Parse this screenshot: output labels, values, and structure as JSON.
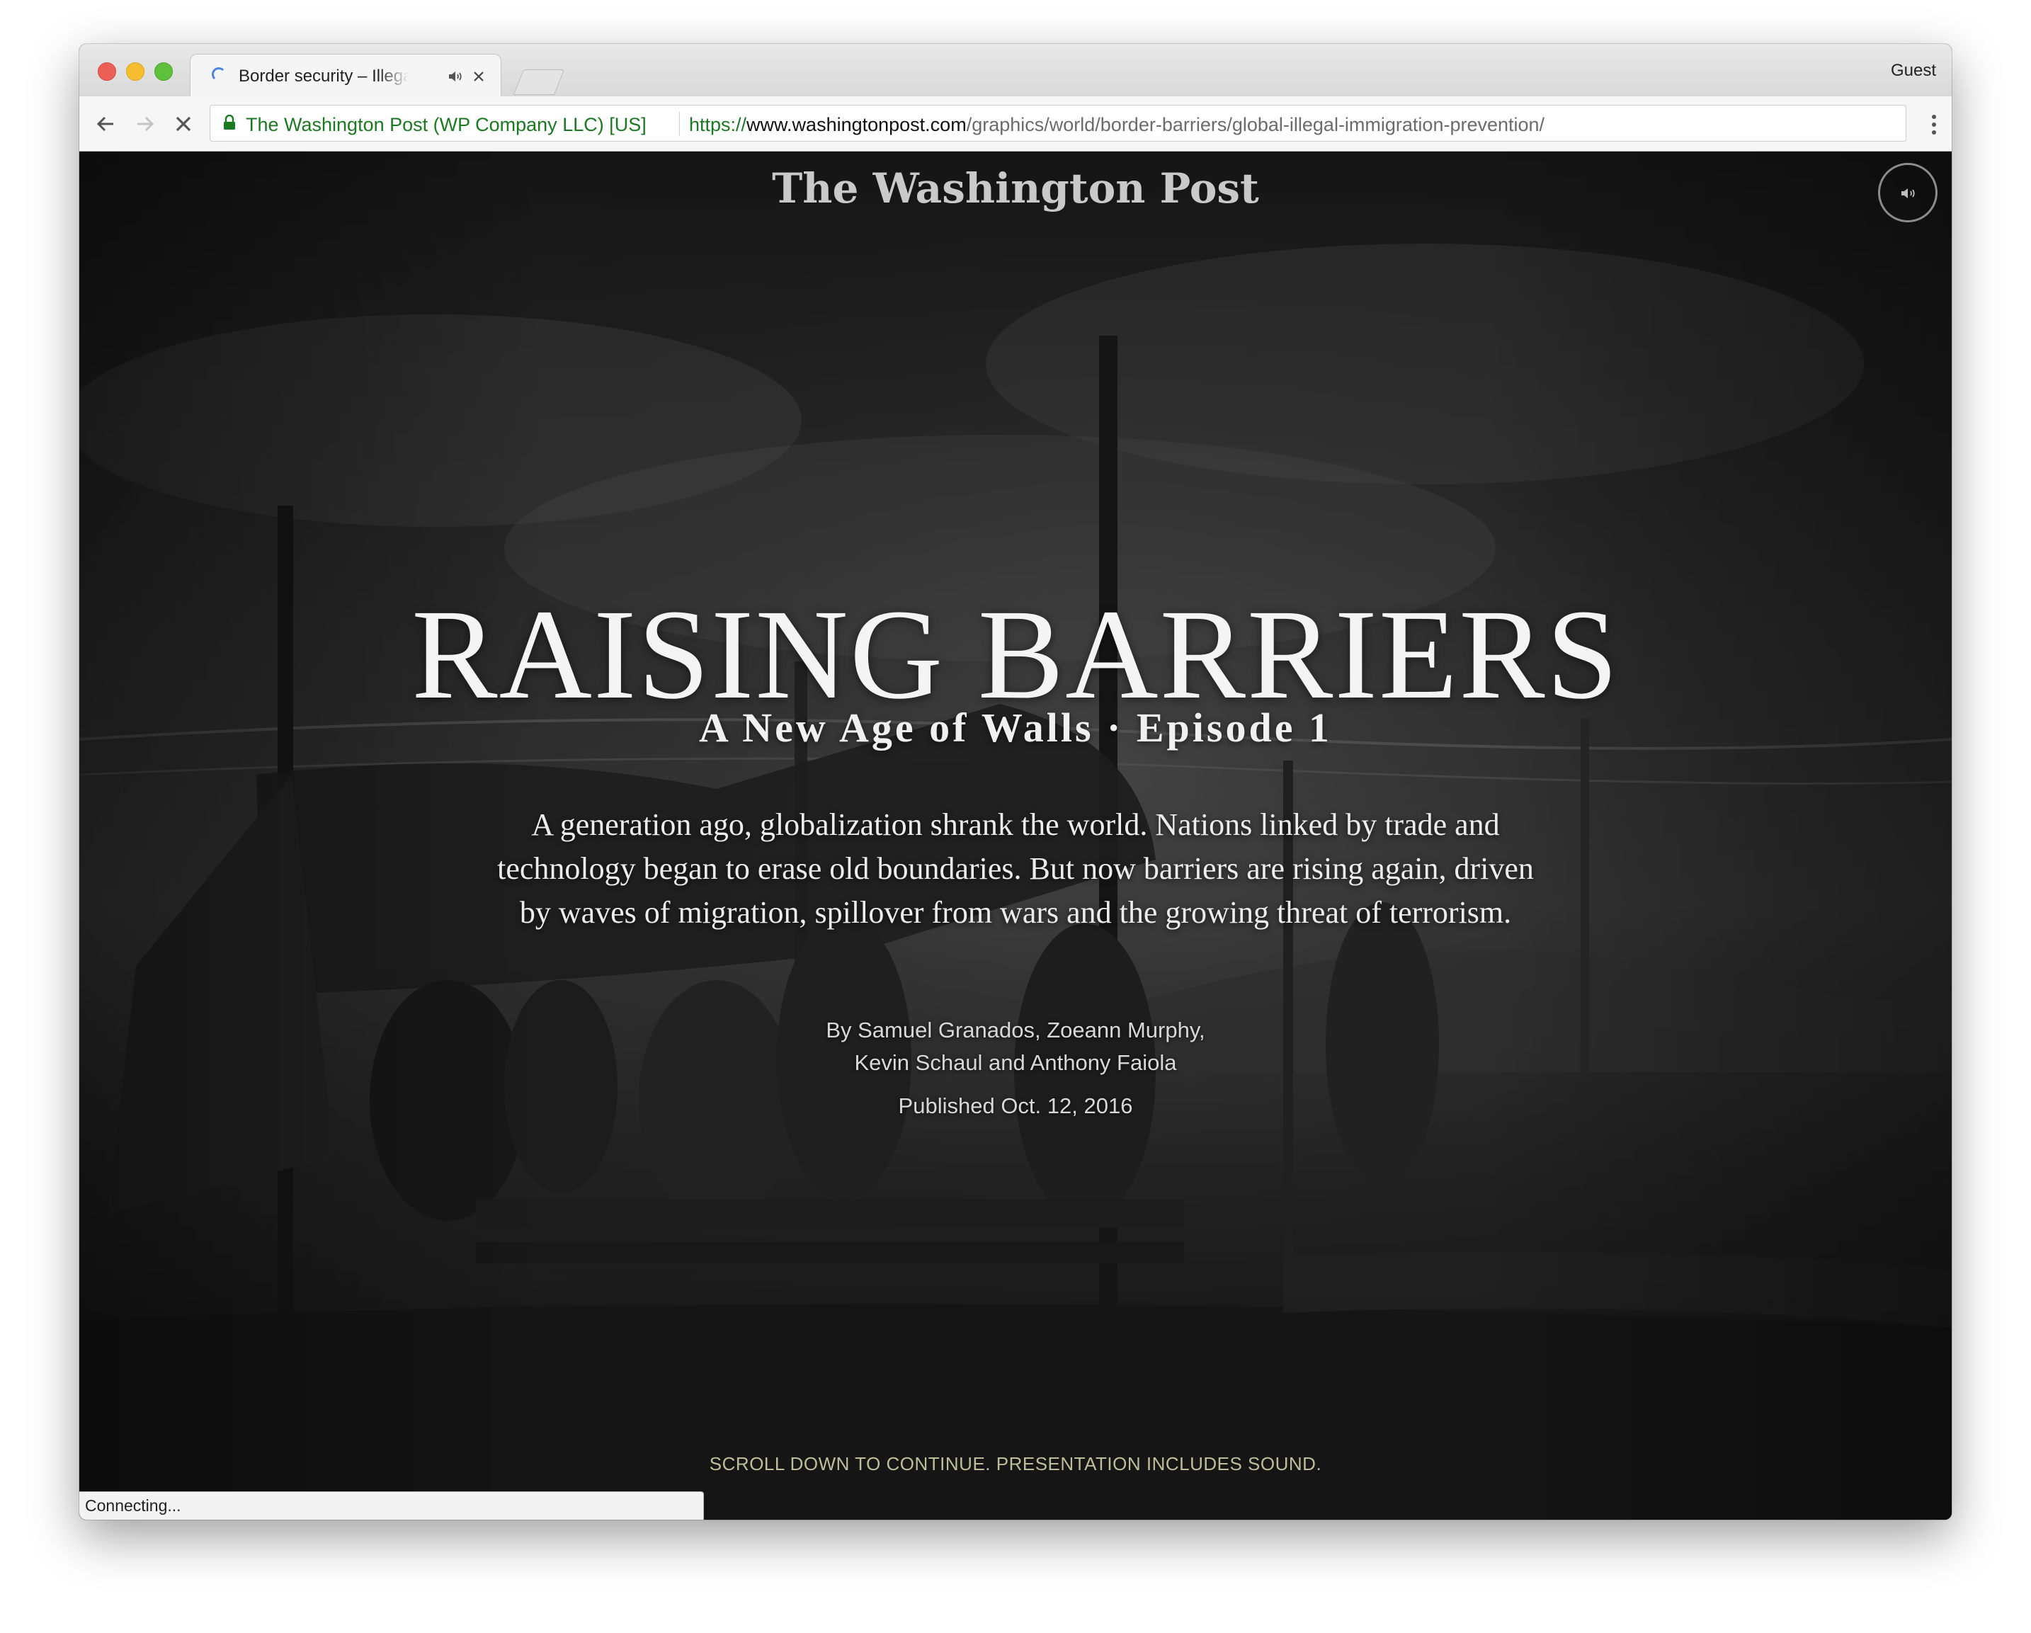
{
  "browser": {
    "tab": {
      "title": "Border security – Illegal immigration prevention"
    },
    "profile_label": "Guest",
    "omnibox": {
      "ev_label": "The Washington Post (WP Company LLC) [US]",
      "url_scheme": "https://",
      "url_host": "www.washingtonpost.com",
      "url_path": "/graphics/world/border-barriers/global-illegal-immigration-prevention/"
    },
    "status_text": "Connecting..."
  },
  "page": {
    "masthead": "The Washington Post",
    "headline": "RAISING BARRIERS",
    "subhead": "A New Age of Walls · Episode 1",
    "dek": [
      "A generation ago, globalization shrank the world. Nations linked by trade and",
      "technology began to erase old boundaries. But now barriers are rising again, driven",
      "by waves of migration, spillover from wars and the growing threat of terrorism."
    ],
    "byline": [
      "By Samuel Granados, Zoeann Murphy,",
      "Kevin Schaul and Anthony Faiola"
    ],
    "published": "Published Oct. 12, 2016",
    "scroll_note": "SCROLL DOWN TO CONTINUE. PRESENTATION INCLUDES SOUND."
  },
  "colors": {
    "ev_green": "#1a7a1f",
    "scroll_note": "#bdbf98",
    "spinner_blue": "#4a86e8"
  }
}
